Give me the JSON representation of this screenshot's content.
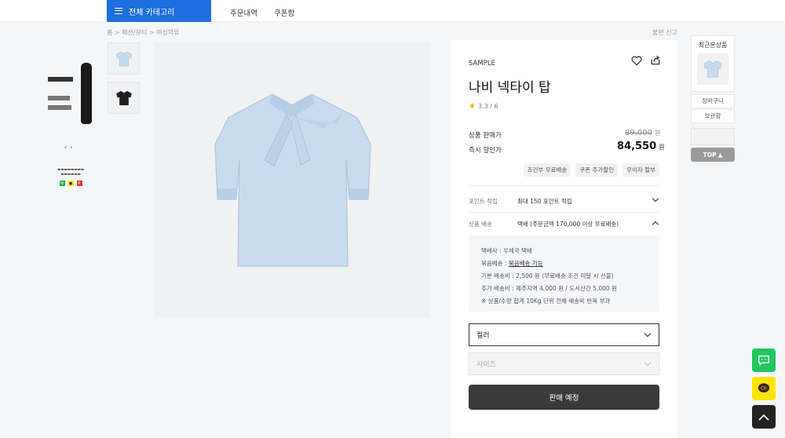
{
  "header": {
    "all_categories_label": "전체 카테고리",
    "nav": [
      "주문내역",
      "쿠폰함"
    ]
  },
  "breadcrumb": "홈 > 패션/뷰티 > 여성의류",
  "report_label": "불편 신고",
  "product": {
    "brand": "SAMPLE",
    "name": "나비 넥타이 탑",
    "rating": "3.3 / 6",
    "price_label": "상품 판매가",
    "original_price": "89,000",
    "discount_label": "즉시 할인가",
    "sale_price": "84,550",
    "currency": "원",
    "tags": [
      "조건부 무료배송",
      "쿠폰 추가할인",
      "무이자 할부"
    ],
    "points_label": "포인트 적립",
    "points_value": "최대 150 포인트 적립",
    "shipping_label": "상품 배송",
    "shipping_value": "택배 (주문금액 170,000 이상 무료배송)",
    "shipping_details": {
      "courier": "택배사 : 우체국 택배",
      "bundle_prefix": "묶음배송 : ",
      "bundle_link": "묶음배송 가능",
      "base_fee": "기본 배송비 : 2,500 원 (무료배송 조건 미달 시 선불)",
      "extra_fee": "추가 배송비 : 제주지역 4,000 원 / 도서산간 5,000 원",
      "note": "※ 상품/수량 합계 10Kg 단위 전체 배송비 반복 부과"
    },
    "options": {
      "color_placeholder": "컬러",
      "size_placeholder": "사이즈"
    },
    "buy_button": "판매 예정"
  },
  "sidebar": {
    "recent_title": "최근본상품",
    "cart_label": "장바구니",
    "wishlist_label": "보관함",
    "top_label": "TOP"
  },
  "colors": {
    "primary": "#1e6fe0",
    "star": "#f6b400",
    "talk_green": "#22c55e",
    "kakao_yellow": "#fde500"
  }
}
